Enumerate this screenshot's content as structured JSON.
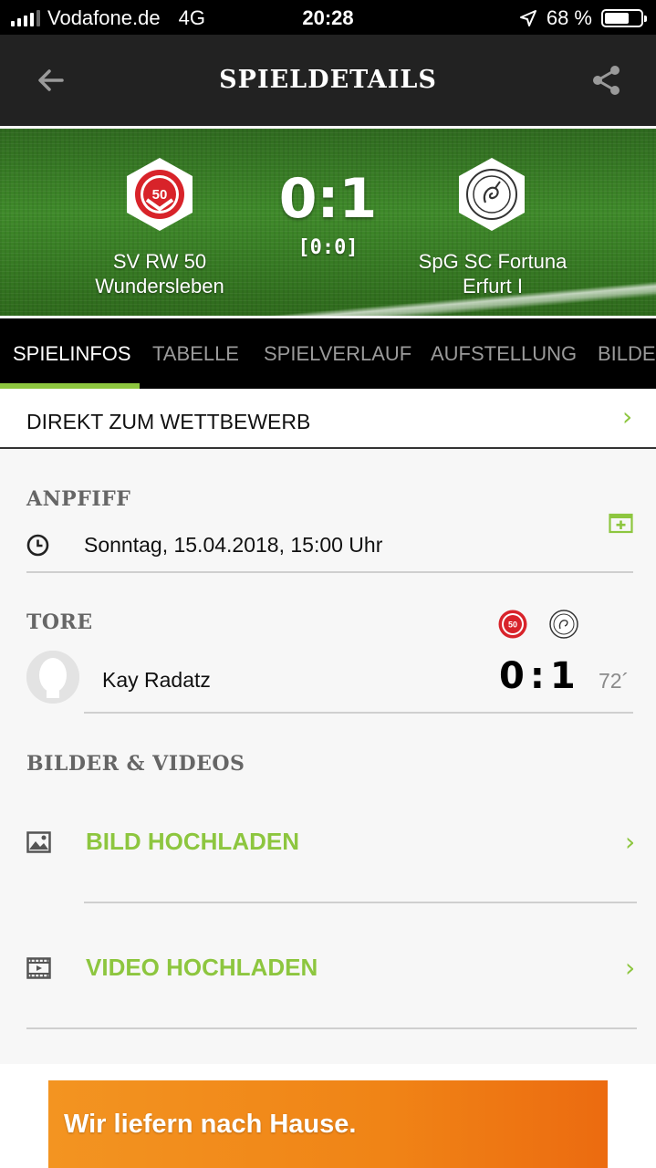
{
  "status_bar": {
    "carrier": "Vodafone.de",
    "network": "4G",
    "time": "20:28",
    "battery": "68 %",
    "battery_level": 0.68
  },
  "navbar": {
    "title": "SPIELDETAILS",
    "back_icon": "arrow-left-icon",
    "share_icon": "share-icon"
  },
  "match": {
    "home_team": {
      "line1": "SV RW 50",
      "line2": "Wundersleben",
      "logo_text": "50"
    },
    "away_team": {
      "line1": "SpG SC Fortuna",
      "line2": "Erfurt I"
    },
    "score": "0:1",
    "halftime": "[0:0]"
  },
  "tabs": [
    {
      "label": "SPIELINFOS",
      "active": true
    },
    {
      "label": "TABELLE",
      "active": false
    },
    {
      "label": "SPIELVERLAUF",
      "active": false
    },
    {
      "label": "AUFSTELLUNG",
      "active": false
    },
    {
      "label": "BILDER",
      "active": false
    }
  ],
  "direct_link": {
    "label": "DIREKT ZUM WETTBEWERB",
    "chevron": "›"
  },
  "kickoff": {
    "heading": "ANPFIFF",
    "datetime": "Sonntag, 15.04.2018, 15:00 Uhr"
  },
  "goals": {
    "heading": "TORE",
    "items": [
      {
        "player": "Kay Radatz",
        "score": "0:1",
        "minute": "72´"
      }
    ]
  },
  "media": {
    "heading": "BILDER & VIDEOS",
    "upload_image": "BILD HOCHLADEN",
    "upload_video": "VIDEO HOCHLADEN",
    "chevron": "›"
  },
  "ad": {
    "text": "Wir liefern nach Hause."
  },
  "colors": {
    "accent_green": "#8dc63f",
    "home_red": "#d8232a",
    "navbar": "#222222",
    "tabs_bg": "#000000",
    "ad_orange": "#f08416"
  }
}
